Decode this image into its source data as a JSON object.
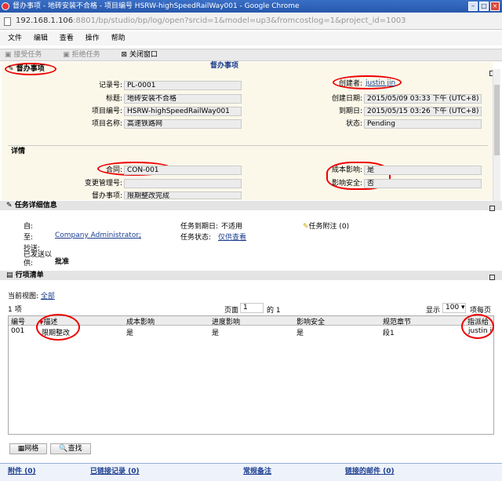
{
  "window": {
    "title": "督办事项 - 地砖安装不合格 - 项目编号 HSRW-highSpeedRailWay001 - Google Chrome"
  },
  "address": {
    "host": "192.168.1.106",
    "path": ":8801/bp/studio/bp/log/open?srcid=1&model=up3&fromcostlog=1&project_id=1003"
  },
  "menu": [
    "文件",
    "编辑",
    "查看",
    "操作",
    "帮助"
  ],
  "toolbar": {
    "accept": "接受任务",
    "reject": "拒绝任务",
    "close": "关闭窗口"
  },
  "header": {
    "tab_label": "督办事项",
    "page_title": "督办事项"
  },
  "record": {
    "record_no_label": "记录号:",
    "record_no": "PL-0001",
    "title_label": "标题:",
    "title": "地砖安装不合格",
    "project_code_label": "项目编号:",
    "project_code": "HSRW-highSpeedRailWay001",
    "project_name_label": "项目名称:",
    "project_name": "高速铁路网",
    "creator_label": "创建者:",
    "creator": "justin jin",
    "created_label": "创建日期:",
    "created": "2015/05/09 03:33 下午 (UTC+8)",
    "due_label": "到期日:",
    "due": "2015/05/15 03:26 下午 (UTC+8)",
    "status_label": "状态:",
    "status": "Pending"
  },
  "details": {
    "heading": "详情",
    "contract_label": "合同:",
    "contract": "CON-001",
    "change_label": "变更管理号:",
    "change": "",
    "item_label": "督办事项:",
    "item": "限期整改完成",
    "cost_label": "成本影响:",
    "cost": "是",
    "safety_label": "影响安全:",
    "safety": "否"
  },
  "task": {
    "heading": "任务详细信息",
    "from_label": "自:",
    "from": "",
    "to_label": "至:",
    "to": "Company Administrator;",
    "cc_label": "抄送:",
    "cc": "",
    "sent_label": "已发送以供:",
    "sent": "批准",
    "due_label": "任务到期日:",
    "due": "不适用",
    "state_label": "任务状态:",
    "state": "仅供查看",
    "attach": "任务附注 (0)"
  },
  "items": {
    "heading": "行项清单",
    "view_label": "当前视图:",
    "view": "全部",
    "count": "1 项",
    "page_label": "页面",
    "page": "1",
    "of_label": "的",
    "total_pages": "1",
    "show_label": "显示",
    "show": "100",
    "per_page": "项每页",
    "columns": [
      "编号",
      "描述",
      "成本影响",
      "进度影响",
      "影响安全",
      "规范章节",
      "指派给"
    ],
    "rows": [
      [
        "001",
        "限期整改",
        "是",
        "是",
        "是",
        "段1",
        "justin j"
      ]
    ]
  },
  "bottom": {
    "grid_button": "网格",
    "find_button": "查找"
  },
  "footer": {
    "attachments": "附件 (0)",
    "linked": "已链接记录 (0)",
    "notes": "常规备注",
    "mail": "链接的邮件 (0)"
  }
}
